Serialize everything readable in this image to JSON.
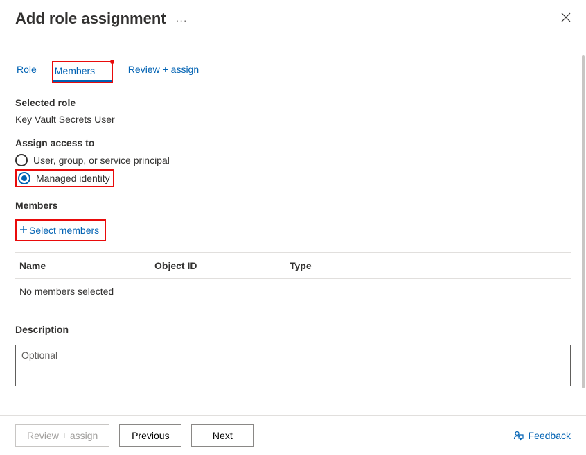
{
  "header": {
    "title": "Add role assignment",
    "more_icon_name": "more-icon",
    "close_icon_name": "close-icon"
  },
  "tabs": {
    "role": "Role",
    "members": "Members",
    "review_assign": "Review + assign",
    "active": "members"
  },
  "selected_role": {
    "label": "Selected role",
    "value": "Key Vault Secrets User"
  },
  "assign_access": {
    "label": "Assign access to",
    "options": {
      "user_group_sp": "User, group, or service principal",
      "managed_identity": "Managed identity"
    },
    "selected": "managed_identity"
  },
  "members": {
    "label": "Members",
    "select_members_label": "Select members",
    "columns": {
      "name": "Name",
      "object_id": "Object ID",
      "type": "Type"
    },
    "empty_text": "No members selected"
  },
  "description": {
    "label": "Description",
    "placeholder": "Optional",
    "value": ""
  },
  "footer": {
    "review_assign": "Review + assign",
    "previous": "Previous",
    "next": "Next",
    "feedback": "Feedback"
  },
  "colors": {
    "link": "#0062b3",
    "highlight": "#e90b0b",
    "text": "#323130",
    "border": "#e1dfdd"
  }
}
